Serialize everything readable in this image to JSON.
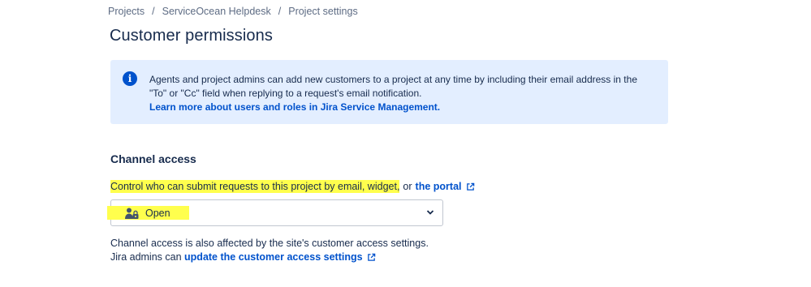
{
  "breadcrumb": {
    "items": [
      "Projects",
      "ServiceOcean Helpdesk",
      "Project settings"
    ],
    "separator": "/"
  },
  "page_title": "Customer permissions",
  "info_panel": {
    "icon": "info-icon",
    "icon_glyph": "i",
    "line1": "Agents and project admins can add new customers to a project at any time by including their email address in the",
    "line2": "\"To\" or \"Cc\" field when replying to a request's email notification.",
    "link": "Learn more about users and roles in Jira Service Management."
  },
  "channel_access": {
    "heading": "Channel access",
    "description_highlighted": "Control who can submit requests to this project by email, widget,",
    "description_or": "or",
    "portal_link": "the portal",
    "select": {
      "icon": "person-lock-icon",
      "value": "Open",
      "chevron": "chevron-down-icon"
    },
    "footer_line1": "Channel access is also affected by the site's customer access settings.",
    "footer_line2_prefix": "Jira admins can",
    "footer_link": "update the customer access settings"
  },
  "colors": {
    "link": "#0052cc",
    "text": "#172b4d",
    "info_bg": "#deebff",
    "highlight": "#ffff4d"
  }
}
